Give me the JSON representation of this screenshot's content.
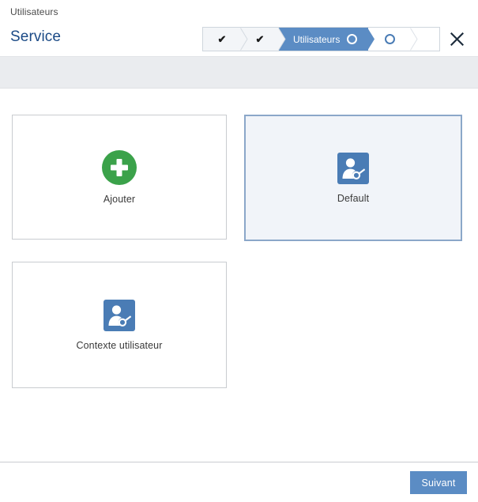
{
  "header": {
    "breadcrumb": "Utilisateurs",
    "title": "Service",
    "close_icon": "close-icon"
  },
  "wizard": {
    "steps": [
      {
        "label": "",
        "state": "done",
        "icon": "check-icon"
      },
      {
        "label": "",
        "state": "done",
        "icon": "check-icon"
      },
      {
        "label": "Utilisateurs",
        "state": "active",
        "icon": "circle-outline-icon"
      },
      {
        "label": "",
        "state": "upcoming",
        "icon": "circle-outline-icon"
      },
      {
        "label": "",
        "state": "upcoming",
        "icon": ""
      }
    ],
    "check_glyph": "✔"
  },
  "colors": {
    "accent_blue": "#5b8cc4",
    "title_blue": "#1b4a86",
    "add_green": "#3ba24a",
    "selected_bg": "#f1f4f9",
    "selected_border": "#8ba7c9",
    "toolbar_gray": "#eaecef"
  },
  "content": {
    "cards": [
      {
        "label": "Ajouter",
        "icon": "add-plus-icon",
        "selected": false
      },
      {
        "label": "Default",
        "icon": "user-tool-icon",
        "selected": true
      },
      {
        "label": "Contexte utilisateur",
        "icon": "user-tool-icon",
        "selected": false
      }
    ]
  },
  "footer": {
    "next_label": "Suivant"
  }
}
